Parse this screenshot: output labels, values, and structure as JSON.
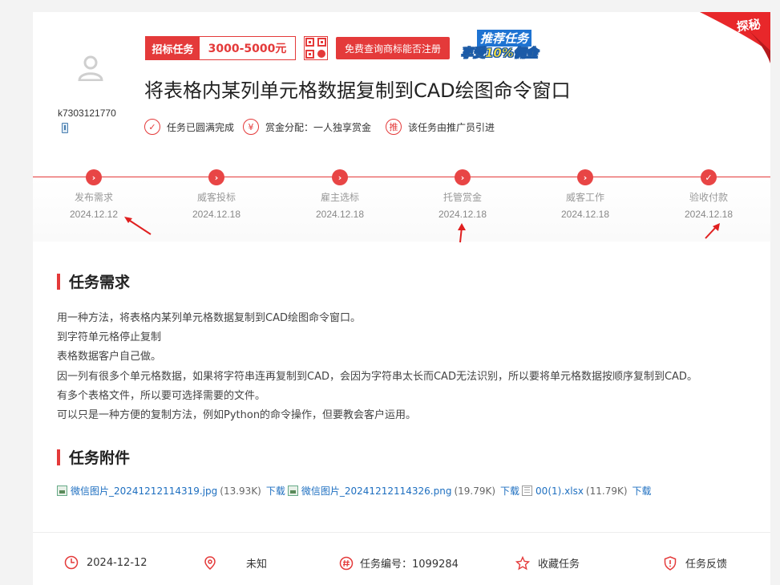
{
  "header": {
    "bid_label": "招标任务",
    "bid_range": "3000-5000元",
    "check_button": "免费查询商标能否注册",
    "promo_line1": "推荐任务",
    "promo_line2": "享受10%佣金",
    "corner_badge": "探秘"
  },
  "user": {
    "name": "k7303121770"
  },
  "task": {
    "title": "将表格内某列单元格数据复制到CAD绘图命令窗口",
    "info": [
      {
        "icon": "check-circle-icon",
        "text": "任务已圆满完成"
      },
      {
        "icon": "yen-circle-icon",
        "text": "赏金分配：一人独享赏金"
      },
      {
        "icon": "promoter-icon",
        "text": "该任务由推广员引进"
      }
    ]
  },
  "steps": [
    {
      "name": "发布需求",
      "date": "2024.12.12"
    },
    {
      "name": "威客投标",
      "date": "2024.12.18"
    },
    {
      "name": "雇主选标",
      "date": "2024.12.18"
    },
    {
      "name": "托管赏金",
      "date": "2024.12.18"
    },
    {
      "name": "威客工作",
      "date": "2024.12.18"
    },
    {
      "name": "验收付款",
      "date": "2024.12.18"
    }
  ],
  "requirements": {
    "title": "任务需求",
    "lines": [
      "用一种方法，将表格内某列单元格数据复制到CAD绘图命令窗口。",
      "到字符单元格停止复制",
      "表格数据客户自己做。",
      "因一列有很多个单元格数据，如果将字符串连再复制到CAD，会因为字符串太长而CAD无法识别，所以要将单元格数据按顺序复制到CAD。",
      "有多个表格文件，所以要可选择需要的文件。",
      "可以只是一种方便的复制方法，例如Python的命令操作，但要教会客户运用。"
    ]
  },
  "attachments": {
    "title": "任务附件",
    "download_label": "下载",
    "files": [
      {
        "name": "微信图片_20241212114319.jpg",
        "size": "(13.93K)",
        "type": "image"
      },
      {
        "name": "微信图片_20241212114326.png",
        "size": "(19.79K)",
        "type": "image"
      },
      {
        "name": "00(1).xlsx",
        "size": "(11.79K)",
        "type": "doc"
      }
    ]
  },
  "footer": {
    "date": "2024-12-12",
    "location": "未知",
    "task_no": "任务编号：1099284",
    "favorite": "收藏任务",
    "feedback": "任务反馈"
  },
  "colors": {
    "accent": "#e43a3a",
    "link": "#1e6fc0"
  }
}
